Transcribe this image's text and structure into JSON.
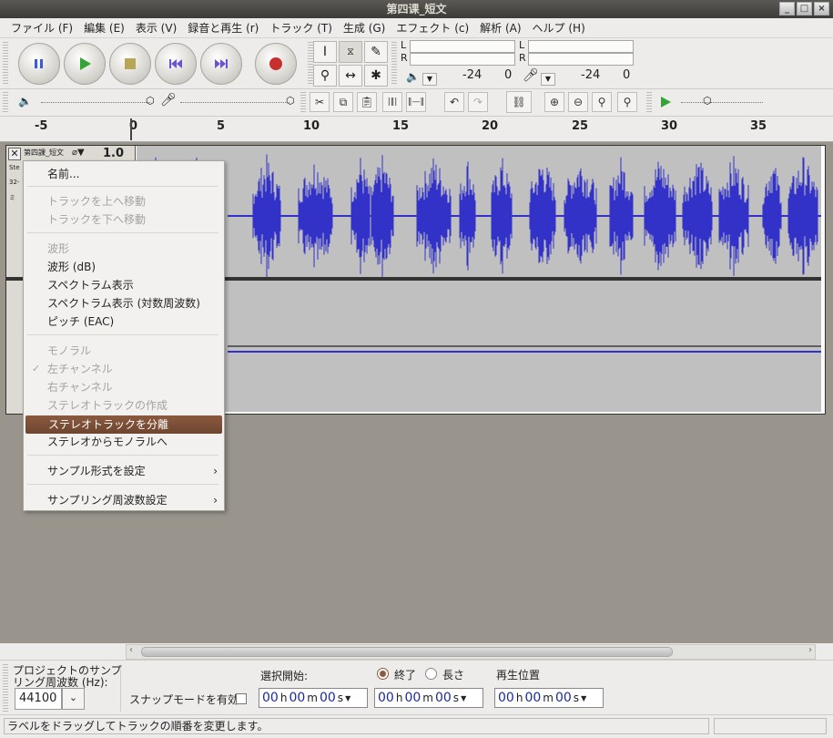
{
  "window": {
    "title": "第四课_短文",
    "buttons": [
      "_",
      "□",
      "×"
    ]
  },
  "menubar": [
    "ファイル (F)",
    "編集 (E)",
    "表示 (V)",
    "録音と再生 (r)",
    "トラック (T)",
    "生成 (G)",
    "エフェクト (c)",
    "解析 (A)",
    "ヘルプ (H)"
  ],
  "meters": {
    "l": "L",
    "r": "R",
    "scale_a": "-24",
    "scale_b": "0",
    "scale_c": "-24",
    "scale_d": "0"
  },
  "ruler": [
    "-5",
    "0",
    "5",
    "10",
    "15",
    "20",
    "25",
    "30",
    "35"
  ],
  "track": {
    "name": "第四課_短文",
    "gain": "1.0",
    "info1": "Ste",
    "info2": "32-",
    "info3": "ミ"
  },
  "context_menu": {
    "items": [
      {
        "label": "名前...",
        "disabled": false
      },
      {
        "label": "トラックを上へ移動",
        "disabled": true
      },
      {
        "label": "トラックを下へ移動",
        "disabled": true
      },
      {
        "label": "波形",
        "disabled": true
      },
      {
        "label": "波形 (dB)",
        "disabled": false
      },
      {
        "label": "スペクトラム表示",
        "disabled": false
      },
      {
        "label": "スペクトラム表示 (対数周波数)",
        "disabled": false
      },
      {
        "label": "ピッチ (EAC)",
        "disabled": false
      },
      {
        "label": "モノラル",
        "disabled": true
      },
      {
        "label": "左チャンネル",
        "disabled": true,
        "check": "✓"
      },
      {
        "label": "右チャンネル",
        "disabled": true
      },
      {
        "label": "ステレオトラックの作成",
        "disabled": true
      },
      {
        "label": "ステレオトラックを分離",
        "highlight": true
      },
      {
        "label": "ステレオからモノラルへ",
        "disabled": false
      },
      {
        "label": "サンプル形式を設定",
        "submenu": "›"
      },
      {
        "label": "サンプリング周波数設定",
        "submenu": "›"
      }
    ]
  },
  "selection_bar": {
    "rate_label_1": "プロジェクトのサンプ",
    "rate_label_2": "リング周波数 (Hz):",
    "rate_value": "44100",
    "snap_label": "スナップモードを有効",
    "sel_start_label": "選択開始:",
    "end_label": "終了",
    "length_label": "長さ",
    "pos_label": "再生位置",
    "time": {
      "hh": "00",
      "h": "h",
      "mm": "00",
      "m": "m",
      "ss": "00",
      "s": "s"
    }
  },
  "status": "ラベルをドラッグしてトラックの順番を変更します。",
  "colors": {
    "wave": "#3232c8",
    "highlight": "#7b4f36"
  }
}
